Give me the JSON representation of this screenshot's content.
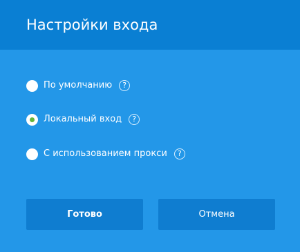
{
  "dialog": {
    "title": "Настройки входа",
    "options": [
      {
        "label": "По умолчанию",
        "checked": false,
        "help_icon": "help-icon",
        "help_text": "?"
      },
      {
        "label": "Локальный вход",
        "checked": true,
        "help_icon": "help-icon",
        "help_text": "?"
      },
      {
        "label": "С использованием прокси",
        "checked": false,
        "help_icon": "help-icon",
        "help_text": "?"
      }
    ],
    "buttons": {
      "ok_label": "Готово",
      "cancel_label": "Отмена"
    }
  },
  "colors": {
    "background": "#2397e8",
    "header": "#0a7fd3",
    "button": "#0f7dd0",
    "selected_dot": "#63b63a",
    "text": "#ffffff"
  }
}
